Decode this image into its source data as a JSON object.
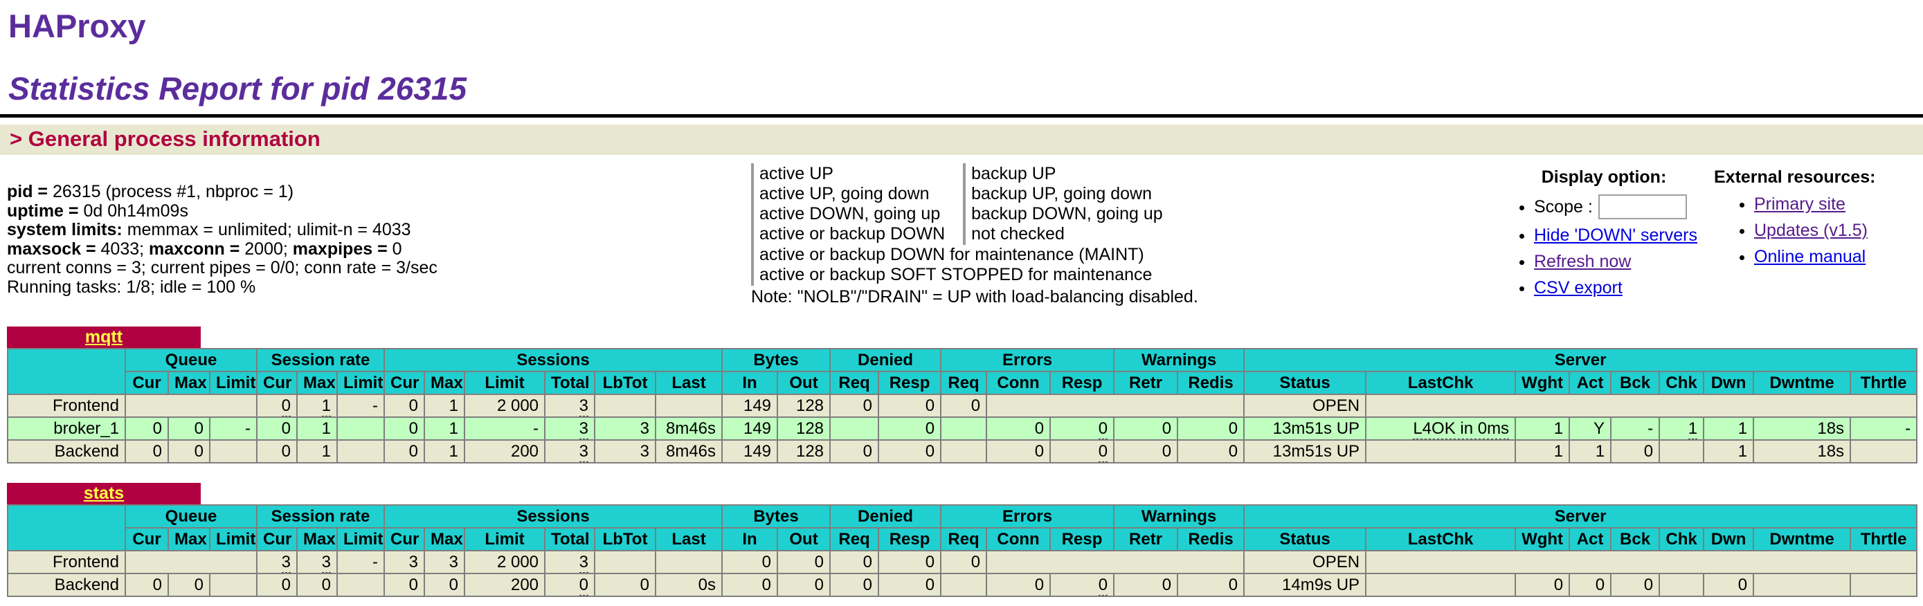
{
  "page": {
    "h1": "HAProxy",
    "h2": "Statistics Report for pid 26315",
    "section_title": "> General process information"
  },
  "colors": {
    "heading_purple": "#5b2d9c",
    "accent_crimson": "#b00040",
    "header_teal": "#20d0d0",
    "row_beige": "#e8e8d0",
    "row_active_up": "#c0ffc0",
    "proxy_title_yellow": "#ffff40"
  },
  "process_info": {
    "lines": [
      [
        {
          "t": "pid = ",
          "b": 1
        },
        {
          "t": "26315 (process #1, nbproc = 1)"
        }
      ],
      [
        {
          "t": "uptime = ",
          "b": 1
        },
        {
          "t": "0d 0h14m09s"
        }
      ],
      [
        {
          "t": "system limits: ",
          "b": 1
        },
        {
          "t": "memmax = unlimited; ulimit-n = 4033"
        }
      ],
      [
        {
          "t": "maxsock = ",
          "b": 1
        },
        {
          "t": "4033; "
        },
        {
          "t": "maxconn = ",
          "b": 1
        },
        {
          "t": "2000; "
        },
        {
          "t": "maxpipes = ",
          "b": 1
        },
        {
          "t": "0"
        }
      ],
      [
        {
          "t": "current conns = 3; current pipes = 0/0; conn rate = 3/sec"
        }
      ],
      [
        {
          "t": "Running tasks: 1/8; idle = 100 %"
        }
      ]
    ]
  },
  "legend": {
    "rows": [
      [
        {
          "label": "active UP",
          "color": "#c0ffc0"
        },
        {
          "label": "backup UP",
          "color": "#b0d0ff"
        }
      ],
      [
        {
          "label": "active UP, going down",
          "color": "#ffffa0"
        },
        {
          "label": "backup UP, going down",
          "color": "#c060ff"
        }
      ],
      [
        {
          "label": "active DOWN, going up",
          "color": "#ffd020"
        },
        {
          "label": "backup DOWN, going up",
          "color": "#ff80ff"
        }
      ],
      [
        {
          "label": "active or backup DOWN",
          "color": "#ff9090"
        },
        {
          "label": "not checked",
          "color": "#e0e0e0"
        }
      ],
      [
        {
          "label": "active or backup DOWN for maintenance (MAINT)",
          "color": "#c07820",
          "wide": true
        }
      ],
      [
        {
          "label": "active or backup SOFT STOPPED for maintenance",
          "color": "#20a0ff",
          "wide": true
        }
      ]
    ],
    "note": "Note: \"NOLB\"/\"DRAIN\" = UP with load-balancing disabled."
  },
  "display_options": {
    "title": "Display option:",
    "scope_label": "Scope :",
    "scope_value": "",
    "links": [
      {
        "label": "Hide 'DOWN' servers",
        "visited": false
      },
      {
        "label": "Refresh now",
        "visited": true
      },
      {
        "label": "CSV export",
        "visited": false
      }
    ]
  },
  "external_resources": {
    "title": "External resources:",
    "links": [
      {
        "label": "Primary site",
        "visited": true
      },
      {
        "label": "Updates (v1.5)",
        "visited": true
      },
      {
        "label": "Online manual",
        "visited": false
      }
    ]
  },
  "tables": [
    {
      "name": "mqtt",
      "groups": [
        {
          "label": "",
          "span": 1
        },
        {
          "label": "Queue",
          "span": 3
        },
        {
          "label": "Session rate",
          "span": 3
        },
        {
          "label": "Sessions",
          "span": 6
        },
        {
          "label": "Bytes",
          "span": 2
        },
        {
          "label": "Denied",
          "span": 2
        },
        {
          "label": "Errors",
          "span": 3
        },
        {
          "label": "Warnings",
          "span": 2
        },
        {
          "label": "Server",
          "span": 9
        }
      ],
      "columns": [
        "",
        "Cur",
        "Max",
        "Limit",
        "Cur",
        "Max",
        "Limit",
        "Cur",
        "Max",
        "Limit",
        "Total",
        "LbTot",
        "Last",
        "In",
        "Out",
        "Req",
        "Resp",
        "Req",
        "Conn",
        "Resp",
        "Retr",
        "Redis",
        "Status",
        "LastChk",
        "Wght",
        "Act",
        "Bck",
        "Chk",
        "Dwn",
        "Dwntme",
        "Thrtle"
      ],
      "rows": [
        {
          "type": "frontend",
          "cells": [
            {
              "t": "Frontend",
              "al": "c"
            },
            {
              "t": "",
              "span": 3
            },
            {
              "t": "0",
              "tip": true
            },
            {
              "t": "1",
              "tip": true
            },
            {
              "t": "-"
            },
            {
              "t": "0"
            },
            {
              "t": "1"
            },
            {
              "t": "2 000"
            },
            {
              "t": "3",
              "tip": true
            },
            {
              "t": ""
            },
            {
              "t": ""
            },
            {
              "t": "149"
            },
            {
              "t": "128"
            },
            {
              "t": "0"
            },
            {
              "t": "0"
            },
            {
              "t": "0"
            },
            {
              "t": "",
              "span": 4
            },
            {
              "t": "OPEN",
              "al": "c"
            },
            {
              "t": "",
              "span": 8
            }
          ]
        },
        {
          "type": "server-up",
          "cells": [
            {
              "t": "broker_1",
              "al": "c"
            },
            {
              "t": "0"
            },
            {
              "t": "0"
            },
            {
              "t": "-"
            },
            {
              "t": "0"
            },
            {
              "t": "1"
            },
            {
              "t": ""
            },
            {
              "t": "0"
            },
            {
              "t": "1"
            },
            {
              "t": "-"
            },
            {
              "t": "3",
              "tip": true
            },
            {
              "t": "3"
            },
            {
              "t": "8m46s"
            },
            {
              "t": "149"
            },
            {
              "t": "128"
            },
            {
              "t": ""
            },
            {
              "t": "0"
            },
            {
              "t": ""
            },
            {
              "t": "0"
            },
            {
              "t": "0",
              "tip": true
            },
            {
              "t": "0"
            },
            {
              "t": "0"
            },
            {
              "t": "13m51s UP",
              "al": "c"
            },
            {
              "t": "L4OK in 0ms",
              "al": "c",
              "tip": true
            },
            {
              "t": "1"
            },
            {
              "t": "Y",
              "al": "c"
            },
            {
              "t": "-",
              "al": "c"
            },
            {
              "t": "1",
              "tip": true
            },
            {
              "t": "1"
            },
            {
              "t": "18s"
            },
            {
              "t": "-",
              "al": "c"
            }
          ]
        },
        {
          "type": "backend",
          "cells": [
            {
              "t": "Backend",
              "al": "c"
            },
            {
              "t": "0"
            },
            {
              "t": "0"
            },
            {
              "t": ""
            },
            {
              "t": "0"
            },
            {
              "t": "1"
            },
            {
              "t": ""
            },
            {
              "t": "0"
            },
            {
              "t": "1"
            },
            {
              "t": "200"
            },
            {
              "t": "3",
              "tip": true
            },
            {
              "t": "3"
            },
            {
              "t": "8m46s"
            },
            {
              "t": "149"
            },
            {
              "t": "128"
            },
            {
              "t": "0"
            },
            {
              "t": "0"
            },
            {
              "t": ""
            },
            {
              "t": "0"
            },
            {
              "t": "0",
              "tip": true
            },
            {
              "t": "0"
            },
            {
              "t": "0"
            },
            {
              "t": "13m51s UP",
              "al": "c"
            },
            {
              "t": ""
            },
            {
              "t": "1"
            },
            {
              "t": "1"
            },
            {
              "t": "0"
            },
            {
              "t": ""
            },
            {
              "t": "1"
            },
            {
              "t": "18s"
            },
            {
              "t": ""
            }
          ]
        }
      ]
    },
    {
      "name": "stats",
      "groups": [
        {
          "label": "",
          "span": 1
        },
        {
          "label": "Queue",
          "span": 3
        },
        {
          "label": "Session rate",
          "span": 3
        },
        {
          "label": "Sessions",
          "span": 6
        },
        {
          "label": "Bytes",
          "span": 2
        },
        {
          "label": "Denied",
          "span": 2
        },
        {
          "label": "Errors",
          "span": 3
        },
        {
          "label": "Warnings",
          "span": 2
        },
        {
          "label": "Server",
          "span": 9
        }
      ],
      "columns": [
        "",
        "Cur",
        "Max",
        "Limit",
        "Cur",
        "Max",
        "Limit",
        "Cur",
        "Max",
        "Limit",
        "Total",
        "LbTot",
        "Last",
        "In",
        "Out",
        "Req",
        "Resp",
        "Req",
        "Conn",
        "Resp",
        "Retr",
        "Redis",
        "Status",
        "LastChk",
        "Wght",
        "Act",
        "Bck",
        "Chk",
        "Dwn",
        "Dwntme",
        "Thrtle"
      ],
      "rows": [
        {
          "type": "frontend",
          "cells": [
            {
              "t": "Frontend",
              "al": "c"
            },
            {
              "t": "",
              "span": 3
            },
            {
              "t": "3",
              "tip": true
            },
            {
              "t": "3",
              "tip": true
            },
            {
              "t": "-"
            },
            {
              "t": "3"
            },
            {
              "t": "3"
            },
            {
              "t": "2 000"
            },
            {
              "t": "3",
              "tip": true
            },
            {
              "t": ""
            },
            {
              "t": ""
            },
            {
              "t": "0"
            },
            {
              "t": "0"
            },
            {
              "t": "0"
            },
            {
              "t": "0"
            },
            {
              "t": "0"
            },
            {
              "t": "",
              "span": 4
            },
            {
              "t": "OPEN",
              "al": "c"
            },
            {
              "t": "",
              "span": 8
            }
          ]
        },
        {
          "type": "backend",
          "cells": [
            {
              "t": "Backend",
              "al": "c"
            },
            {
              "t": "0"
            },
            {
              "t": "0"
            },
            {
              "t": ""
            },
            {
              "t": "0"
            },
            {
              "t": "0"
            },
            {
              "t": ""
            },
            {
              "t": "0"
            },
            {
              "t": "0"
            },
            {
              "t": "200"
            },
            {
              "t": "0",
              "tip": true
            },
            {
              "t": "0"
            },
            {
              "t": "0s"
            },
            {
              "t": "0"
            },
            {
              "t": "0"
            },
            {
              "t": "0"
            },
            {
              "t": "0"
            },
            {
              "t": ""
            },
            {
              "t": "0"
            },
            {
              "t": "0",
              "tip": true
            },
            {
              "t": "0"
            },
            {
              "t": "0"
            },
            {
              "t": "14m9s UP",
              "al": "c"
            },
            {
              "t": ""
            },
            {
              "t": "0"
            },
            {
              "t": "0"
            },
            {
              "t": "0"
            },
            {
              "t": ""
            },
            {
              "t": "0"
            },
            {
              "t": ""
            },
            {
              "t": ""
            }
          ]
        }
      ]
    }
  ]
}
